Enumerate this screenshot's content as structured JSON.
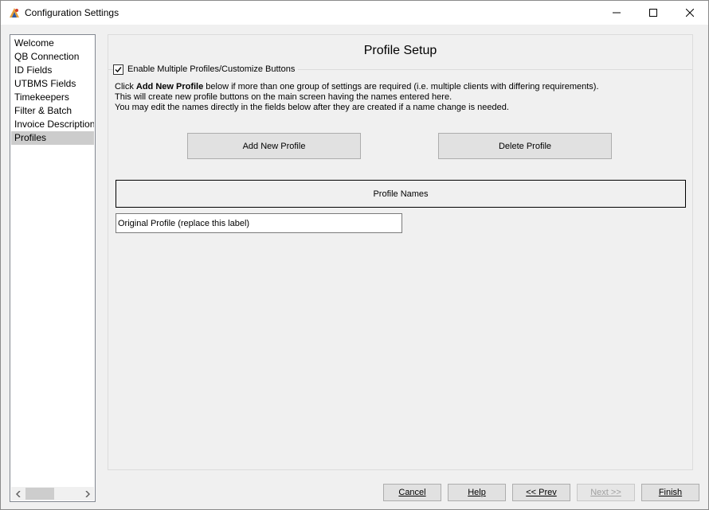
{
  "window": {
    "title": "Configuration Settings"
  },
  "nav": {
    "items": [
      {
        "label": "Welcome"
      },
      {
        "label": "QB Connection"
      },
      {
        "label": "ID Fields"
      },
      {
        "label": "UTBMS Fields"
      },
      {
        "label": "Timekeepers"
      },
      {
        "label": "Filter & Batch"
      },
      {
        "label": "Invoice Description"
      },
      {
        "label": "Profiles"
      }
    ],
    "selected": "Profiles"
  },
  "page": {
    "title": "Profile Setup",
    "enable_label": "Enable Multiple Profiles/Customize Buttons",
    "enable_checked": true,
    "instructions": {
      "line1_prefix": "Click ",
      "line1_bold": "Add New Profile",
      "line1_suffix": " below if more than one group of settings are required (i.e. multiple clients with differing requirements).",
      "line2": "This will create new profile buttons on the main screen having the names entered here.",
      "line3": "You may edit the names directly in the fields below after they are created if a name change is needed."
    },
    "add_button": "Add New Profile",
    "delete_button": "Delete Profile",
    "profile_names_header": "Profile Names",
    "profiles": [
      {
        "value": "Original Profile (replace this label)"
      }
    ]
  },
  "footer": {
    "cancel": "Cancel",
    "help": "Help",
    "prev": "<< Prev",
    "next": "Next >>",
    "finish": "Finish"
  }
}
